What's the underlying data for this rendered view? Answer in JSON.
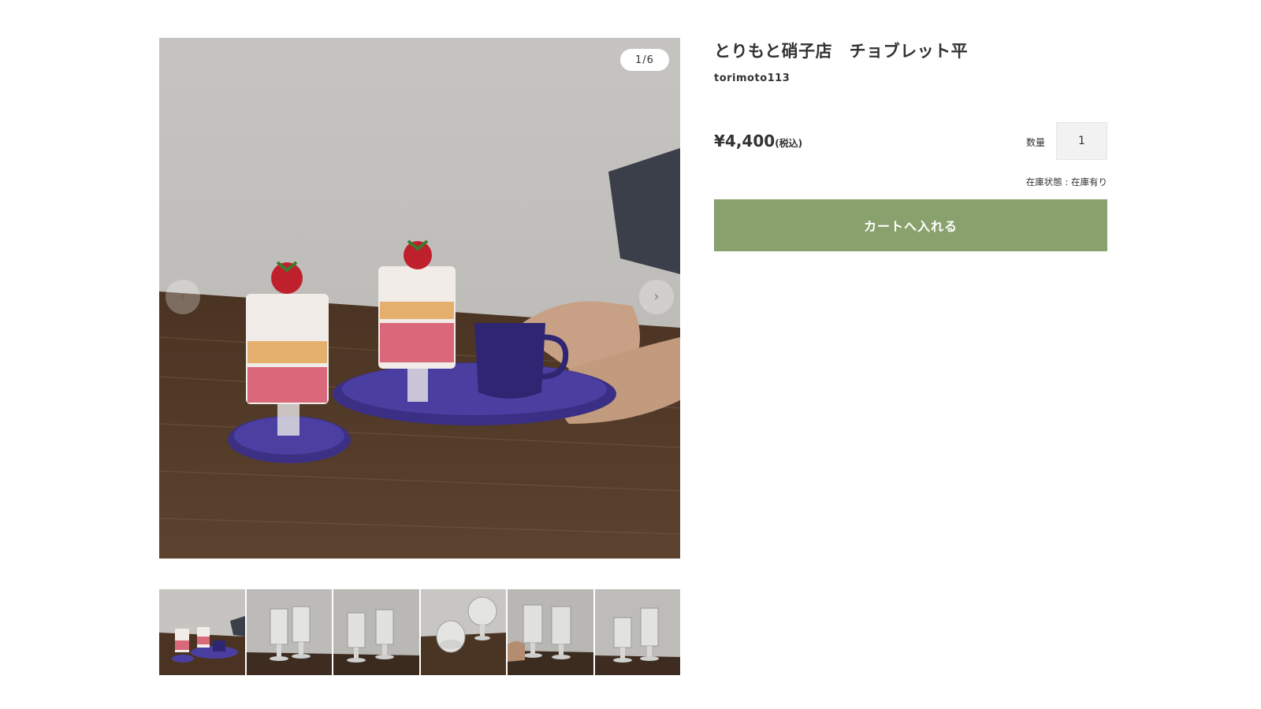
{
  "gallery": {
    "counter": "1/6",
    "prev_icon": "‹",
    "next_icon": "›",
    "main_image": "strawberry parfait glasses on purple plates on wooden table",
    "thumbnails": [
      {
        "label": "thumbnail-1"
      },
      {
        "label": "thumbnail-2"
      },
      {
        "label": "thumbnail-3"
      },
      {
        "label": "thumbnail-4"
      },
      {
        "label": "thumbnail-5"
      },
      {
        "label": "thumbnail-6"
      }
    ]
  },
  "product": {
    "title": "とりもと硝子店　チョブレット平",
    "shop": "torimoto113",
    "price": "¥4,400",
    "tax_label": "(税込)",
    "quantity_label": "数量",
    "quantity_value": "1",
    "stock_status": "在庫状態 : 在庫有り",
    "cart_button": "カートへ入れる"
  },
  "colors": {
    "cart_button_bg": "#89a16d",
    "text": "#333333"
  }
}
